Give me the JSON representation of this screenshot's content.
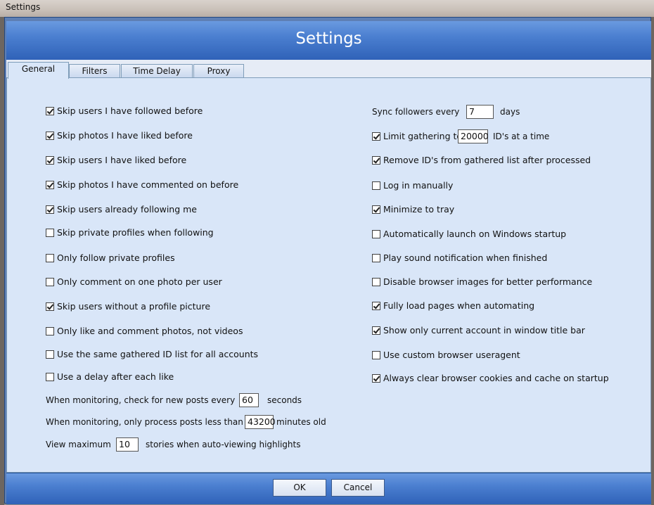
{
  "window": {
    "title": "Settings"
  },
  "header": {
    "title": "Settings"
  },
  "tabs": [
    {
      "label": "General",
      "active": true
    },
    {
      "label": "Filters",
      "active": false
    },
    {
      "label": "Time Delay",
      "active": false
    },
    {
      "label": "Proxy",
      "active": false
    }
  ],
  "left": {
    "options": [
      {
        "label": "Skip users I have followed before",
        "checked": true
      },
      {
        "label": "Skip photos I have liked before",
        "checked": true
      },
      {
        "label": "Skip users I have liked before",
        "checked": true
      },
      {
        "label": "Skip photos I have commented on before",
        "checked": true
      },
      {
        "label": "Skip users already following me",
        "checked": true
      },
      {
        "label": "Skip private profiles when following",
        "checked": false
      },
      {
        "label": "Only follow private profiles",
        "checked": false
      },
      {
        "label": "Only comment on one photo per user",
        "checked": false
      },
      {
        "label": "Skip users without a profile picture",
        "checked": true
      },
      {
        "label": "Only like and comment photos, not videos",
        "checked": false
      },
      {
        "label": "Use the same gathered ID list for all accounts",
        "checked": false
      },
      {
        "label": "Use a delay after each like",
        "checked": false
      }
    ],
    "monitor_check": {
      "prefix": "When monitoring, check for new posts every",
      "value": "60",
      "suffix": "seconds"
    },
    "monitor_age": {
      "prefix": "When monitoring, only process posts less than",
      "value": "43200",
      "suffix": "minutes old"
    },
    "stories": {
      "prefix": "View maximum",
      "value": "10",
      "suffix": "stories when auto-viewing highlights"
    }
  },
  "right": {
    "sync": {
      "prefix": "Sync followers every",
      "value": "7",
      "suffix": "days"
    },
    "limit": {
      "label": "Limit gathering to",
      "checked": true,
      "value": "20000",
      "suffix": "ID's at a time"
    },
    "options": [
      {
        "label": "Remove ID's from gathered list after processed",
        "checked": true
      },
      {
        "label": "Log in manually",
        "checked": false
      },
      {
        "label": "Minimize to tray",
        "checked": true
      },
      {
        "label": "Automatically launch on Windows startup",
        "checked": false
      },
      {
        "label": "Play sound notification when finished",
        "checked": false
      },
      {
        "label": "Disable browser images for better performance",
        "checked": false
      },
      {
        "label": "Fully load pages when automating",
        "checked": true
      },
      {
        "label": "Show only current account in window title bar",
        "checked": true
      },
      {
        "label": "Use custom browser useragent",
        "checked": false
      },
      {
        "label": "Always clear browser cookies and cache on startup",
        "checked": true
      }
    ]
  },
  "buttons": {
    "ok": "OK",
    "cancel": "Cancel"
  }
}
